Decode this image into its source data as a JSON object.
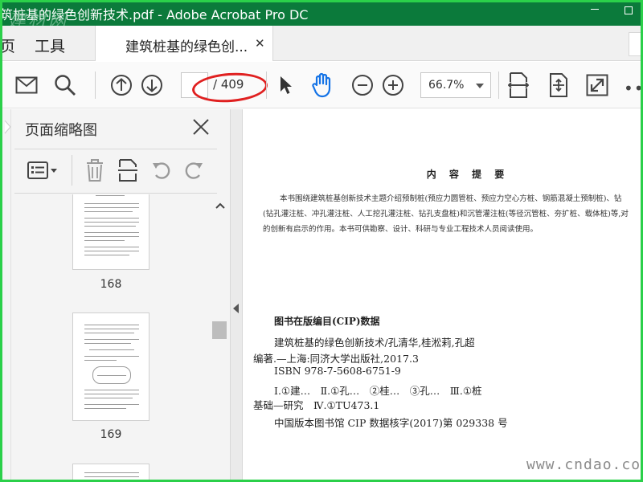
{
  "window": {
    "title": "筑桩基的绿色创新技术.pdf - Adobe Acrobat Pro DC",
    "logo_watermark": "建材网",
    "minimize_label": "minimize",
    "maximize_label": "maximize"
  },
  "tabs": {
    "home_label": "页",
    "tools_label": "工具",
    "document_label": "建筑桩基的绿色创...",
    "close_glyph": "✕"
  },
  "toolbar": {
    "current_page": "",
    "total_pages": "/ 409",
    "zoom": "66.7%",
    "more_glyph": "•••",
    "icons": [
      "mail-icon",
      "search-icon",
      "arrow-up-icon",
      "arrow-down-icon",
      "select-pointer-icon",
      "hand-icon",
      "zoom-out-icon",
      "zoom-in-icon",
      "fit-width-icon",
      "fit-page-icon",
      "fullscreen-icon"
    ]
  },
  "panel": {
    "title": "页面缩略图",
    "close_glyph": "✕",
    "thumbnails": [
      {
        "page": "168"
      },
      {
        "page": "169"
      }
    ]
  },
  "document": {
    "heading": "内 容 提 要",
    "summary_lines": [
      "本书围绕建筑桩基创新技术主题介绍预制桩(预应力圆管桩、预应力空心方桩、钢筋混凝土预制桩)、钻",
      "(钻孔灌注桩、冲孔灌注桩、人工挖孔灌注桩、钻孔支盘桩)和沉管灌注桩(等径沉管桩、夯扩桩、载体桩)等,对",
      "的创新有启示的作用。本书可供勘察、设计、科研与专业工程技术人员阅读使用。"
    ],
    "cip_title": "图书在版编目(CIP)数据",
    "cip_lines": [
      "建筑桩基的绿色创新技术/孔清华,桂淞莉,孔超",
      "编著.—上海:同济大学出版社,2017.3",
      "ISBN 978-7-5608-6751-9",
      "Ⅰ.①建…　Ⅱ.①孔…　②桂…　③孔…　Ⅲ.①桩",
      "基础—研究　Ⅳ.①TU473.1",
      "中国版本图书馆 CIP 数据核字(2017)第 029338 号"
    ]
  },
  "watermark_text": "www.cndao.com",
  "colors": {
    "titlebar": "#0b7a3b",
    "frame": "#2bd04a",
    "annotation": "#e02020",
    "hand_tool": "#1473e6"
  }
}
